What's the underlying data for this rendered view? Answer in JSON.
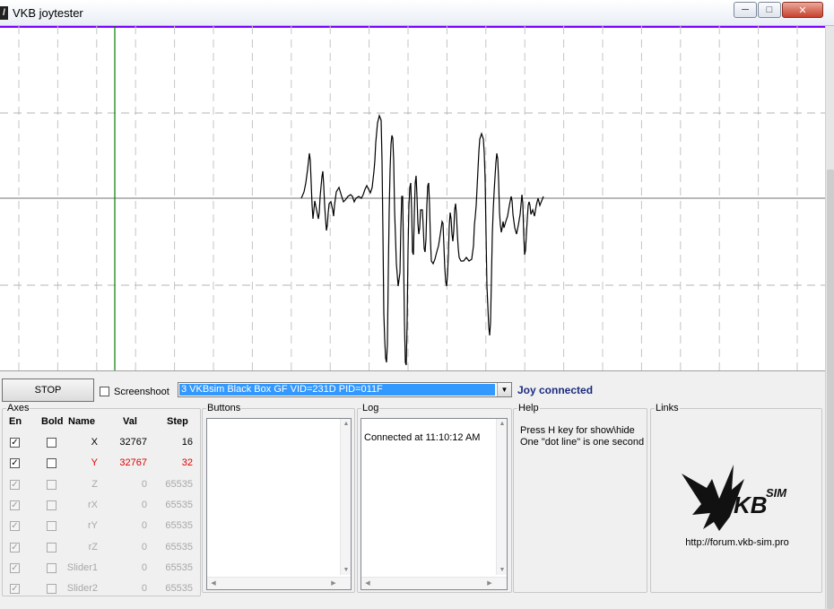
{
  "window": {
    "title": "VKB joytester",
    "app_icon": "vkb-icon",
    "minimize_icon": "minimize-icon",
    "maximize_icon": "maximize-icon",
    "close_icon": "close-icon"
  },
  "plot": {
    "cursor_color": "#008000",
    "center_line_color": "#a0a0a0",
    "top_line_color": "#8000ff",
    "trace_color": "#000000"
  },
  "toolbar": {
    "stop_label": "STOP",
    "screenshot_label": "Screenshoot",
    "screenshot_checked": false,
    "device_selected": "3 VKBsim Black Box GF  VID=231D PID=011F",
    "joy_status": "Joy connected"
  },
  "axes": {
    "legend": "Axes",
    "headers": {
      "en": "En",
      "bold": "Bold",
      "name": "Name",
      "val": "Val",
      "step": "Step"
    },
    "rows": [
      {
        "name": "X",
        "val": "32767",
        "step": "16",
        "en": true,
        "bold": false,
        "state": "active"
      },
      {
        "name": "Y",
        "val": "32767",
        "step": "32",
        "en": true,
        "bold": false,
        "state": "highlight"
      },
      {
        "name": "Z",
        "val": "0",
        "step": "65535",
        "en": true,
        "bold": false,
        "state": "disabled"
      },
      {
        "name": "rX",
        "val": "0",
        "step": "65535",
        "en": true,
        "bold": false,
        "state": "disabled"
      },
      {
        "name": "rY",
        "val": "0",
        "step": "65535",
        "en": true,
        "bold": false,
        "state": "disabled"
      },
      {
        "name": "rZ",
        "val": "0",
        "step": "65535",
        "en": true,
        "bold": false,
        "state": "disabled"
      },
      {
        "name": "Slider1",
        "val": "0",
        "step": "65535",
        "en": true,
        "bold": false,
        "state": "disabled"
      },
      {
        "name": "Slider2",
        "val": "0",
        "step": "65535",
        "en": true,
        "bold": false,
        "state": "disabled"
      }
    ]
  },
  "buttons_panel": {
    "legend": "Buttons"
  },
  "log_panel": {
    "legend": "Log",
    "lines": [
      "Connected at 11:10:12 AM"
    ]
  },
  "help_panel": {
    "legend": "Help",
    "line1": "Press H key for show\\hide",
    "line2": "One \"dot line\" is one second"
  },
  "links_panel": {
    "legend": "Links",
    "logo": "vkbsim-logo",
    "logo_text": "KB",
    "logo_sup": "SIM",
    "url": "http://forum.vkb-sim.pro"
  }
}
